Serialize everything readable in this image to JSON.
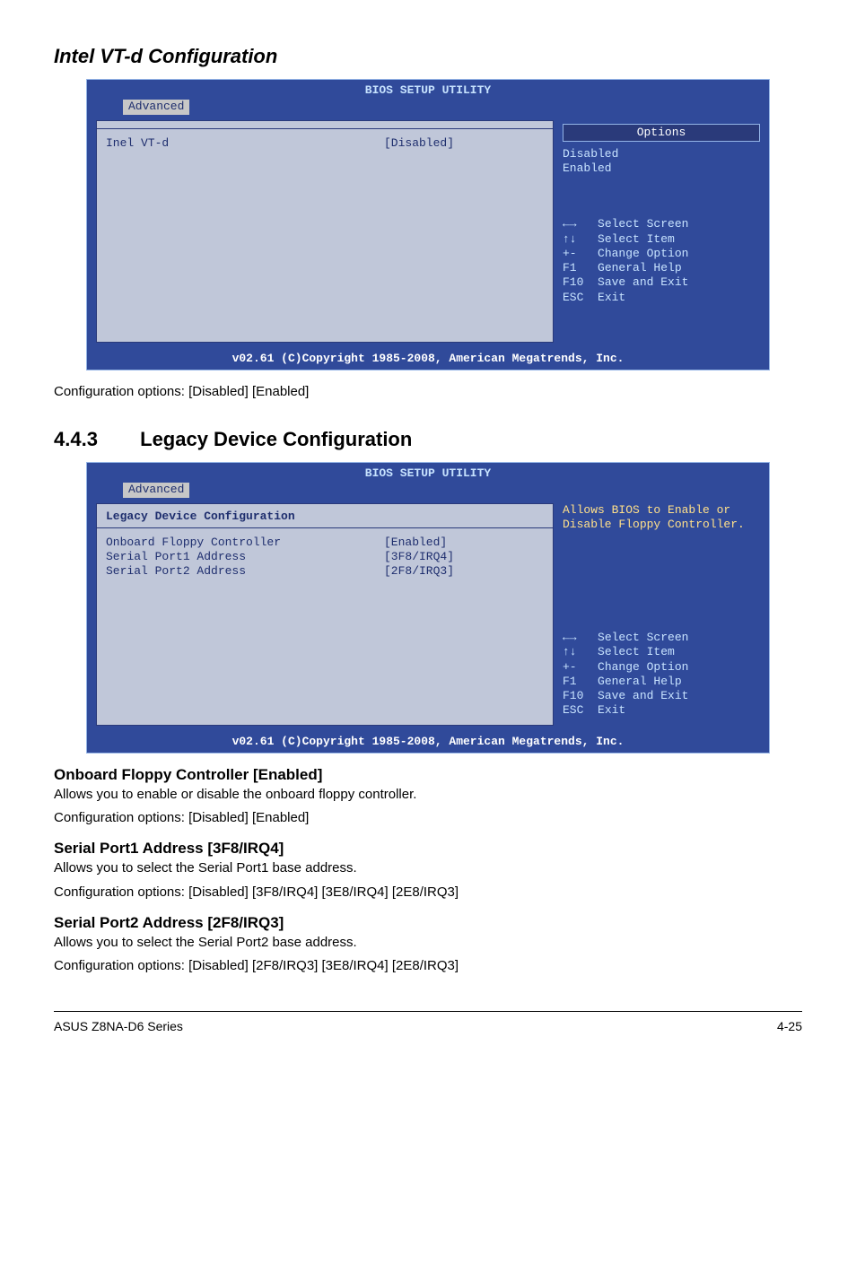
{
  "section1_title": "Intel VT-d Configuration",
  "bios1": {
    "title": "BIOS SETUP UTILITY",
    "tab": "Advanced",
    "left": {
      "rows": [
        {
          "label": "Inel VT-d",
          "value": "[Disabled]"
        }
      ]
    },
    "right": {
      "options_header": "Options",
      "options": [
        "Disabled",
        "Enabled"
      ],
      "keys": [
        {
          "k": "←→",
          "d": "Select Screen"
        },
        {
          "k": "↑↓",
          "d": "Select Item"
        },
        {
          "k": "+-",
          "d": "Change Option"
        },
        {
          "k": "F1",
          "d": "General Help"
        },
        {
          "k": "F10",
          "d": "Save and Exit"
        },
        {
          "k": "ESC",
          "d": "Exit"
        }
      ]
    },
    "copyright": "v02.61 (C)Copyright 1985-2008, American Megatrends, Inc."
  },
  "config_line_1": "Configuration options: [Disabled] [Enabled]",
  "section2_num": "4.4.3",
  "section2_title": "Legacy Device Configuration",
  "bios2": {
    "title": "BIOS SETUP UTILITY",
    "tab": "Advanced",
    "left": {
      "heading": "Legacy Device Configuration",
      "rows": [
        {
          "label": "Onboard Floppy Controller",
          "value": "[Enabled]"
        },
        {
          "label": "Serial Port1 Address",
          "value": "[3F8/IRQ4]"
        },
        {
          "label": "Serial Port2 Address",
          "value": "[2F8/IRQ3]"
        }
      ]
    },
    "right": {
      "help": "Allows BIOS to Enable or Disable Floppy Controller.",
      "keys": [
        {
          "k": "←→",
          "d": "Select Screen"
        },
        {
          "k": "↑↓",
          "d": "Select Item"
        },
        {
          "k": "+-",
          "d": "Change Option"
        },
        {
          "k": "F1",
          "d": "General Help"
        },
        {
          "k": "F10",
          "d": "Save and Exit"
        },
        {
          "k": "ESC",
          "d": "Exit"
        }
      ]
    },
    "copyright": "v02.61 (C)Copyright 1985-2008, American Megatrends, Inc."
  },
  "ofc_h": "Onboard Floppy Controller [Enabled]",
  "ofc_p1": "Allows you to enable or disable the onboard floppy controller.",
  "ofc_p2": "Configuration options: [Disabled] [Enabled]",
  "sp1_h": "Serial Port1 Address [3F8/IRQ4]",
  "sp1_p1": "Allows you to select the Serial Port1 base address.",
  "sp1_p2": "Configuration options: [Disabled] [3F8/IRQ4] [3E8/IRQ4] [2E8/IRQ3]",
  "sp2_h": "Serial Port2 Address [2F8/IRQ3]",
  "sp2_p1": "Allows you to select the Serial Port2 base address.",
  "sp2_p2": "Configuration options: [Disabled] [2F8/IRQ3] [3E8/IRQ4] [2E8/IRQ3]",
  "footer_left": "ASUS Z8NA-D6 Series",
  "footer_right": "4-25"
}
